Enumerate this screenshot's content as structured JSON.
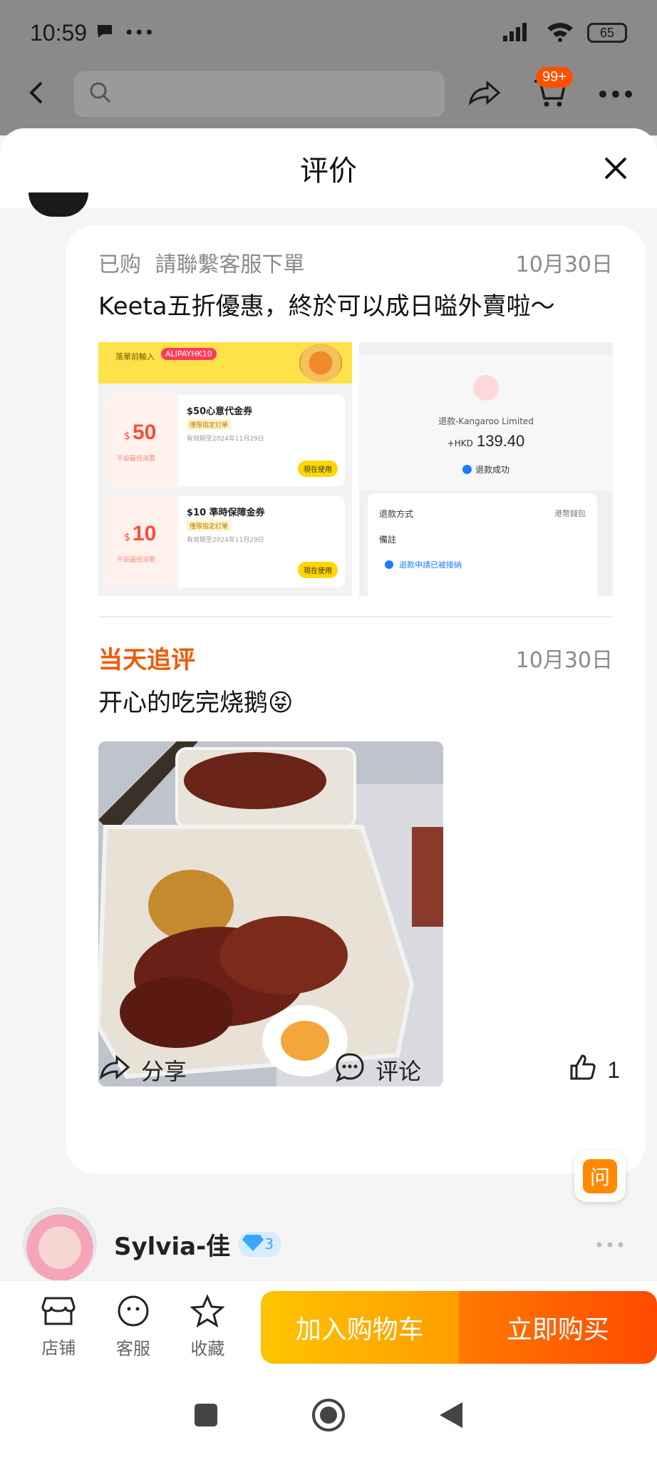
{
  "status_bar": {
    "time": "10:59",
    "battery": "65",
    "more": "•••"
  },
  "topnav": {
    "cart_badge": "99+"
  },
  "sheet": {
    "title": "评价"
  },
  "review": {
    "purchase_label": "已购",
    "variant": "請聯繫客服下單",
    "date": "10月30日",
    "text": "Keeta五折優惠，終於可以成日嗌外賣啦～",
    "coupon_image": {
      "banner_label": "落單前輸入",
      "banner_code": "ALIPAYHK10",
      "coupons": [
        {
          "amount": "50",
          "prefix": "$",
          "sub": "不設最低消費",
          "title": "$50心意代金券",
          "tag": "僅限指定訂單",
          "note": "有效期至2024年11月29日",
          "button": "現在使用"
        },
        {
          "amount": "10",
          "prefix": "$",
          "sub": "不設最低消費",
          "title": "$10 準時保障金券",
          "tag": "僅限指定訂單",
          "note": "有效期至2024年11月29日",
          "button": "現在使用"
        }
      ]
    },
    "refund_image": {
      "merchant": "退款-Kangaroo Limited",
      "currency": "+HKD",
      "amount": "139.40",
      "status": "退款成功",
      "method_label": "退款方式",
      "method_value": "港幣錢包",
      "remark_label": "備註",
      "step_text": "退款申請已被接納"
    },
    "followup": {
      "title": "当天追评",
      "date": "10月30日",
      "text": "开心的吃完烧鹅😝"
    },
    "actions": {
      "share": "分享",
      "comment": "评论",
      "like_count": "1"
    }
  },
  "ask_button": "问",
  "next_user": {
    "name": "Sylvia-佳",
    "level": "3"
  },
  "bottom_bar": {
    "shop": "店铺",
    "service": "客服",
    "favorite": "收藏",
    "add_to_cart": "加入购物车",
    "buy_now": "立即购买"
  },
  "colors": {
    "accent": "#f05a00",
    "cart_btn": "#ffb000",
    "buy_btn": "#ff5a00",
    "badge": "#ff5000"
  }
}
